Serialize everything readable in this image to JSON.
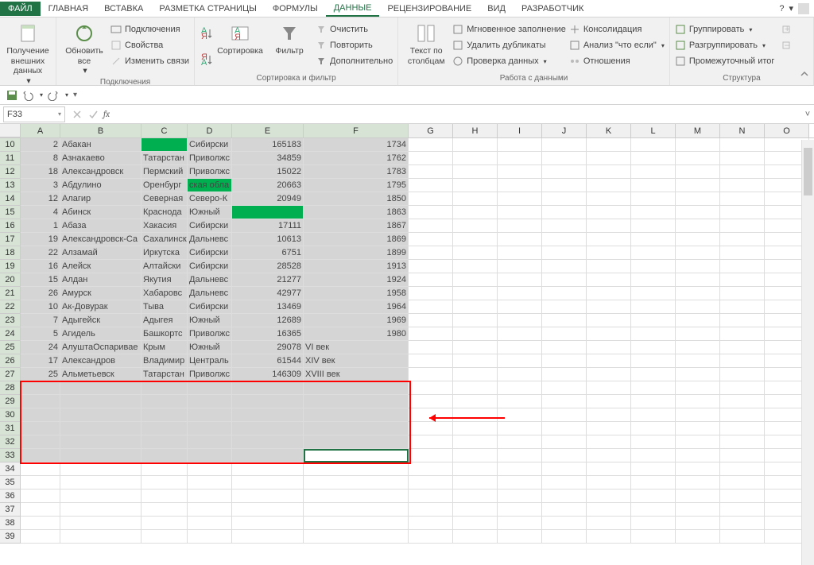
{
  "tabs": {
    "file": "ФАЙЛ",
    "main": "ГЛАВНАЯ",
    "insert": "ВСТАВКА",
    "layout": "РАЗМЕТКА СТРАНИЦЫ",
    "formulas": "ФОРМУЛЫ",
    "data": "ДАННЫЕ",
    "review": "РЕЦЕНЗИРОВАНИЕ",
    "view": "ВИД",
    "developer": "РАЗРАБОТЧИК"
  },
  "ribbon": {
    "getdata": {
      "label": "Получение\nвнешних данных",
      "group": ""
    },
    "connections": {
      "refresh": "Обновить\nвсе",
      "conns": "Подключения",
      "props": "Свойства",
      "editlinks": "Изменить связи",
      "group": "Подключения"
    },
    "sort": {
      "sort": "Сортировка",
      "filter": "Фильтр",
      "clear": "Очистить",
      "reapply": "Повторить",
      "advanced": "Дополнительно",
      "group": "Сортировка и фильтр"
    },
    "datatools": {
      "texttocols": "Текст по\nстолбцам",
      "flash": "Мгновенное заполнение",
      "dupes": "Удалить дубликаты",
      "validation": "Проверка данных",
      "consolidate": "Консолидация",
      "whatif": "Анализ \"что если\"",
      "relations": "Отношения",
      "group": "Работа с данными"
    },
    "outline": {
      "group": "Группировать",
      "ungroup": "Разгруппировать",
      "subtotal": "Промежуточный итог",
      "grouplabel": "Структура"
    }
  },
  "namebox": "F33",
  "cols": [
    "A",
    "B",
    "C",
    "D",
    "E",
    "F",
    "G",
    "H",
    "I",
    "J",
    "K",
    "L",
    "M",
    "N",
    "O"
  ],
  "rows": [
    {
      "n": 10,
      "a": 2,
      "b": "Абакан",
      "c": "",
      "d": "Сибирски",
      "e": 165183,
      "f": 1734,
      "greenC": true
    },
    {
      "n": 11,
      "a": 8,
      "b": "Азнакаево",
      "c": "Татарстан",
      "d": "Приволжс",
      "e": 34859,
      "f": 1762
    },
    {
      "n": 12,
      "a": 18,
      "b": "Александровск",
      "c": "Пермский",
      "d": "Приволжс",
      "e": 15022,
      "f": 1783
    },
    {
      "n": 13,
      "a": 3,
      "b": "Абдулино",
      "c": "Оренбург",
      "d": "ская обла",
      "e": 20663,
      "f": 1795,
      "greenD": true
    },
    {
      "n": 14,
      "a": 12,
      "b": "Алагир",
      "c": "Северная",
      "d": "Северо-К",
      "e": 20949,
      "f": 1850
    },
    {
      "n": 15,
      "a": 4,
      "b": "Абинск",
      "c": "Краснода",
      "d": "Южный",
      "e": "",
      "f": 1863,
      "greenE": true
    },
    {
      "n": 16,
      "a": 1,
      "b": "Абаза",
      "c": "Хакасия",
      "d": "Сибирски",
      "e": 17111,
      "f": 1867
    },
    {
      "n": 17,
      "a": 19,
      "b": "Александровск-Са",
      "c": "Сахалинск",
      "d": "Дальневс",
      "e": 10613,
      "f": 1869
    },
    {
      "n": 18,
      "a": 22,
      "b": "Алзамай",
      "c": "Иркутска",
      "d": "Сибирски",
      "e": 6751,
      "f": 1899
    },
    {
      "n": 19,
      "a": 16,
      "b": "Алейск",
      "c": "Алтайски",
      "d": "Сибирски",
      "e": 28528,
      "f": 1913
    },
    {
      "n": 20,
      "a": 15,
      "b": "Алдан",
      "c": "Якутия",
      "d": "Дальневс",
      "e": 21277,
      "f": 1924
    },
    {
      "n": 21,
      "a": 26,
      "b": "Амурск",
      "c": "Хабаровс",
      "d": "Дальневс",
      "e": 42977,
      "f": 1958
    },
    {
      "n": 22,
      "a": 10,
      "b": "Ак-Довурак",
      "c": "Тыва",
      "d": "Сибирски",
      "e": 13469,
      "f": 1964
    },
    {
      "n": 23,
      "a": 7,
      "b": "Адыгейск",
      "c": "Адыгея",
      "d": "Южный",
      "e": 12689,
      "f": 1969
    },
    {
      "n": 24,
      "a": 5,
      "b": "Агидель",
      "c": "Башкортс",
      "d": "Приволжс",
      "e": 16365,
      "f": 1980
    },
    {
      "n": 25,
      "a": 24,
      "b": "АлуштаОспаривае",
      "c": "Крым",
      "d": "Южный",
      "e": 29078,
      "f": "VI век"
    },
    {
      "n": 26,
      "a": 17,
      "b": "Александров",
      "c": "Владимир",
      "d": "Централь",
      "e": 61544,
      "f": "XIV век"
    },
    {
      "n": 27,
      "a": 25,
      "b": "Альметьевск",
      "c": "Татарстан",
      "d": "Приволжс",
      "e": 146309,
      "f": "XVIII век"
    }
  ],
  "emptyrows_sel": [
    28,
    29,
    30,
    31,
    32,
    33
  ],
  "emptyrows": [
    34,
    35,
    36,
    37,
    38,
    39
  ]
}
